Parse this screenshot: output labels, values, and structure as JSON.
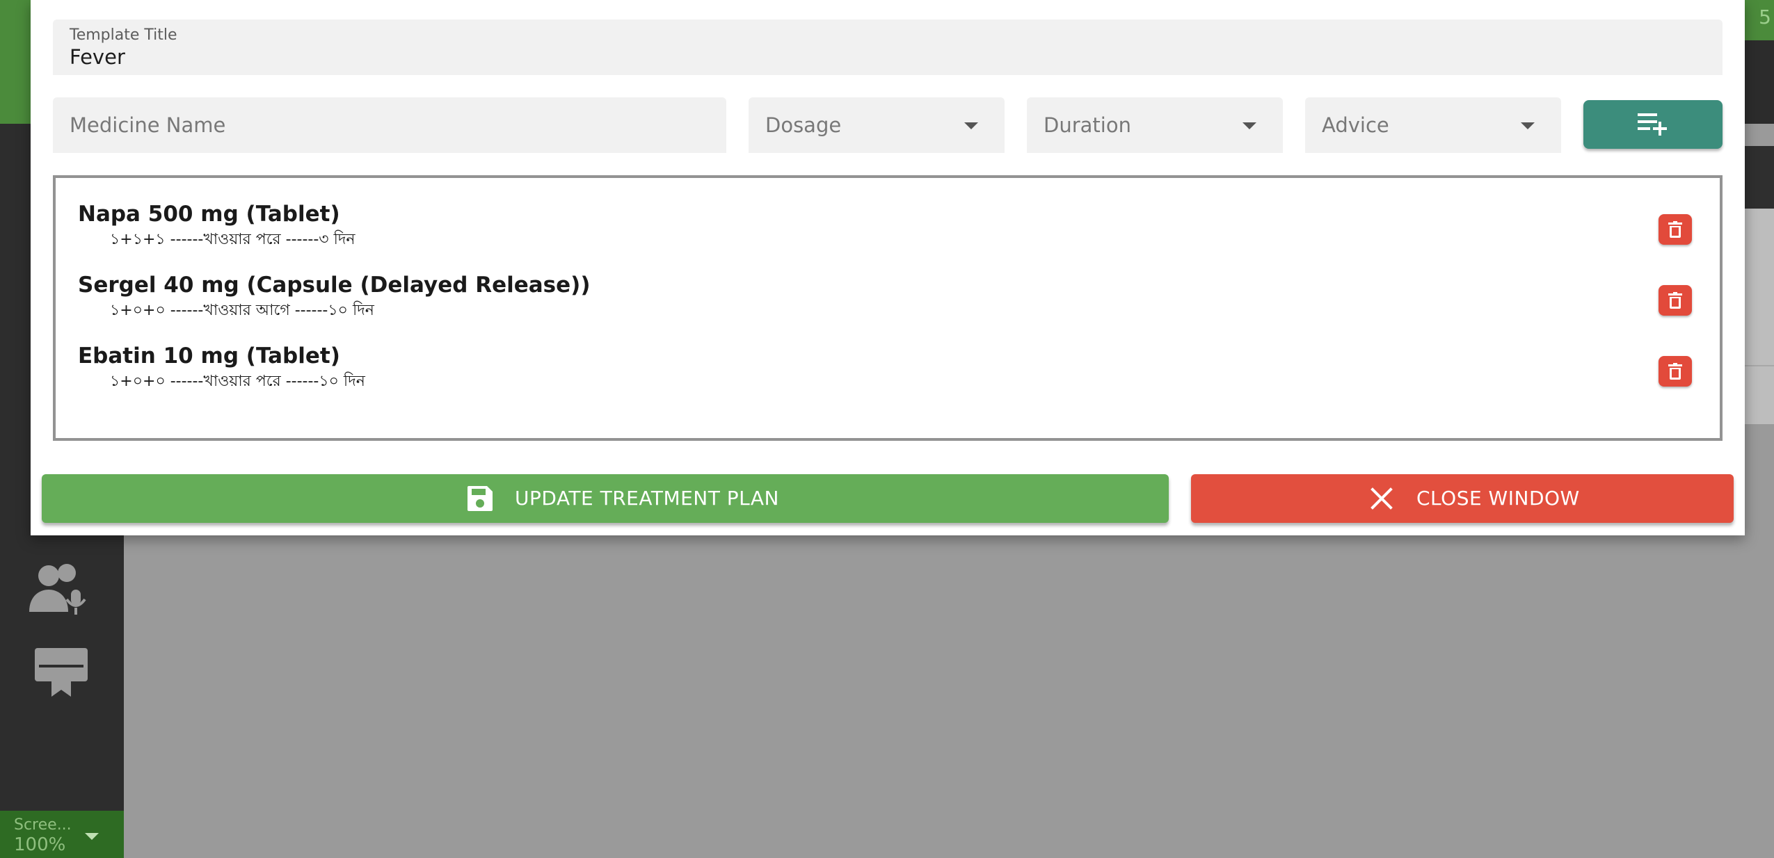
{
  "background": {
    "corner_number": "5",
    "screen_selector": {
      "label": "Scree...",
      "value": "100%"
    }
  },
  "modal": {
    "template_title": {
      "label": "Template Title",
      "value": "Fever"
    },
    "medicine_input": {
      "placeholder": "Medicine Name"
    },
    "dosage_select": {
      "placeholder": "Dosage"
    },
    "duration_select": {
      "placeholder": "Duration"
    },
    "advice_select": {
      "placeholder": "Advice"
    },
    "add_button_icon": "playlist-add-icon",
    "medicines": [
      {
        "name": "Napa 500 mg (Tablet)",
        "detail": "১+১+১ ------খাওয়ার পরে ------৩ দিন"
      },
      {
        "name": "Sergel 40 mg (Capsule (Delayed Release))",
        "detail": "১+০+০ ------খাওয়ার আগে ------১০ দিন"
      },
      {
        "name": "Ebatin 10 mg (Tablet)",
        "detail": "১+০+০ ------খাওয়ার পরে ------১০ দিন"
      }
    ],
    "update_button": {
      "label": "UPDATE TREATMENT PLAN",
      "icon": "save-icon"
    },
    "close_button": {
      "label": "CLOSE WINDOW",
      "icon": "close-icon"
    }
  },
  "colors": {
    "update_green": "#65ad58",
    "close_red": "#e24f3e",
    "add_teal": "#3c8d7c",
    "delete_red": "#e24a3b",
    "sidebar_dark": "#2d2d2d",
    "topbar_green": "#4b8b3b"
  }
}
